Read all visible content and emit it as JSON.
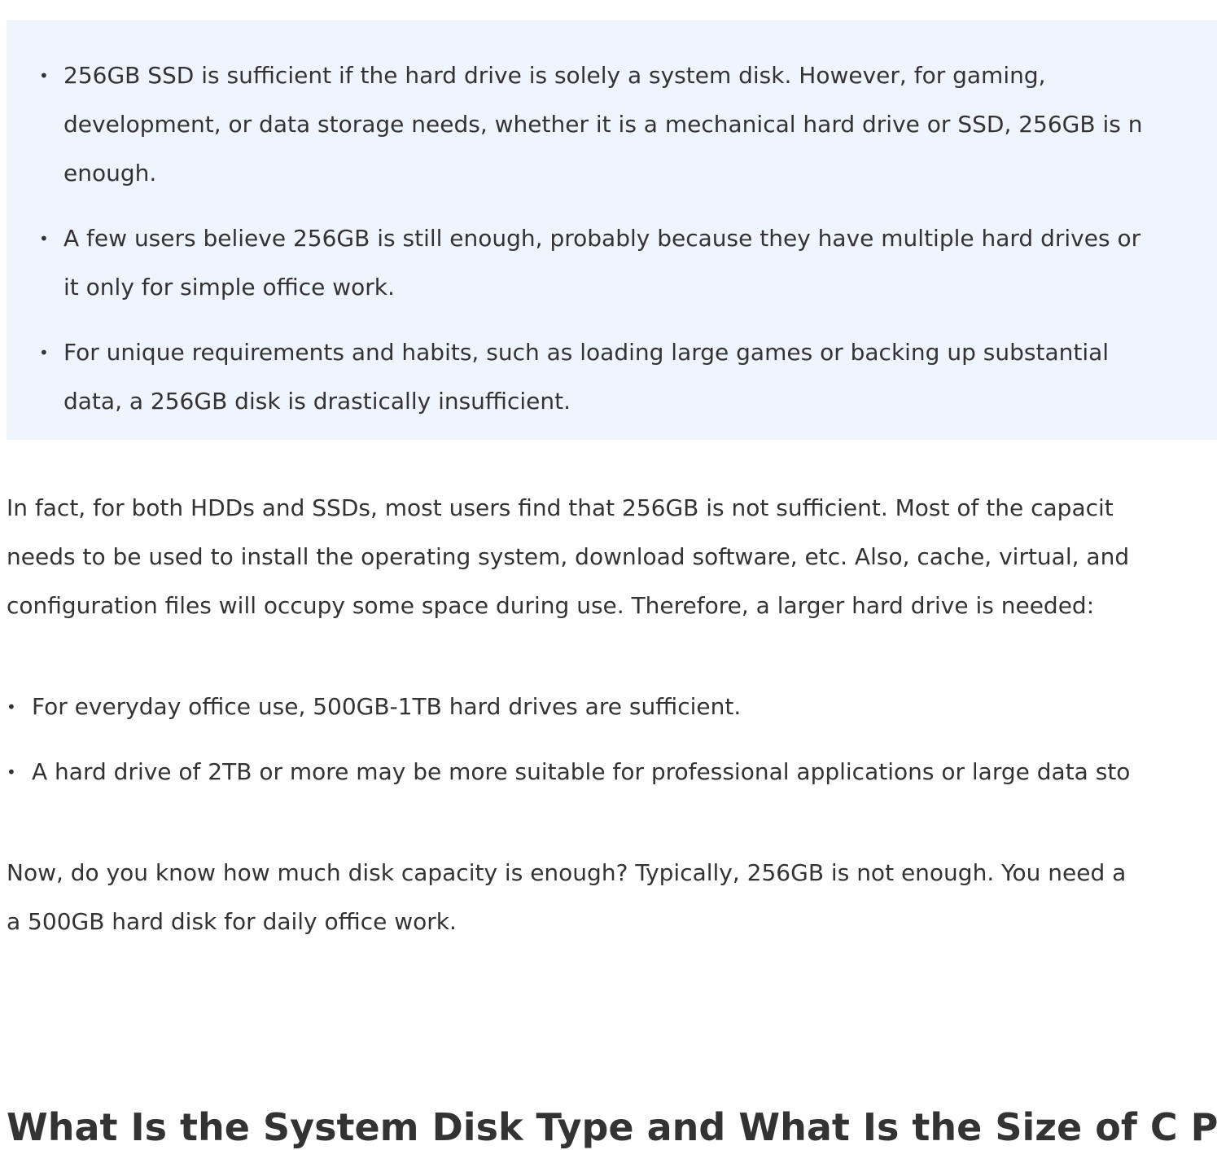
{
  "callout": {
    "items": [
      {
        "bullet": "•",
        "lines": [
          "256GB SSD is sufficient if the hard drive is solely a system disk. However, for gaming,",
          "development, or data storage needs, whether it is a mechanical hard drive or SSD, 256GB is n",
          "enough."
        ]
      },
      {
        "bullet": "•",
        "lines": [
          "A few users believe 256GB is still enough, probably because they have multiple hard drives or",
          "it only for simple office work."
        ]
      },
      {
        "bullet": "•",
        "lines": [
          "For unique requirements and habits, such as loading large games or backing up substantial",
          "data, a 256GB disk is drastically insufficient."
        ]
      }
    ]
  },
  "paragraph1": {
    "lines": [
      "In fact, for both HDDs and SSDs, most users find that 256GB is not sufficient. Most of the capacit",
      "needs to be used to install the operating system, download software, etc. Also, cache, virtual, and",
      "configuration files will occupy some space during use. Therefore, a larger hard drive is needed:"
    ]
  },
  "list2": {
    "items": [
      {
        "bullet": "•",
        "text": "For everyday office use, 500GB-1TB hard drives are sufficient."
      },
      {
        "bullet": "•",
        "text": "A hard drive of 2TB or more may be more suitable for professional applications or large data sto"
      }
    ]
  },
  "paragraph2": {
    "lines": [
      "Now, do you know how much disk capacity is enough? Typically, 256GB is not enough. You need a",
      "a 500GB hard disk for daily office work."
    ]
  },
  "heading": {
    "text": "What Is the System Disk Type and What Is the Size of C Partit"
  }
}
